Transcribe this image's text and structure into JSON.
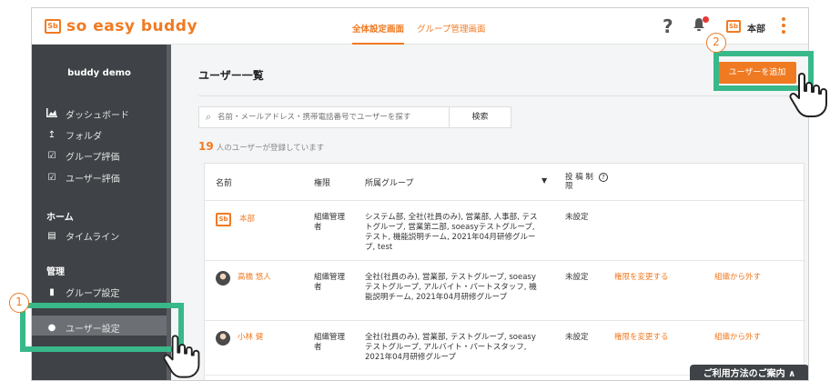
{
  "app": {
    "logo_box": "Sb",
    "logo_text": "so easy buddy",
    "nav": [
      "全体設定画面",
      "グループ管理画面"
    ],
    "help": "?",
    "user_box": "Sb",
    "user_name": "本部"
  },
  "sidebar": {
    "org": "buddy demo",
    "items": [
      {
        "icon": "dashboard-icon",
        "label": "ダッシュボード"
      },
      {
        "icon": "folder-up-icon",
        "label": "フォルダ"
      },
      {
        "icon": "check-icon",
        "label": "グループ評価"
      },
      {
        "icon": "check-icon",
        "label": "ユーザー評価"
      }
    ],
    "home_head": "ホーム",
    "timeline": "タイムライン",
    "manage_head": "管理",
    "group_settings": "グループ設定",
    "user_settings": "ユーザー設定"
  },
  "main": {
    "title": "ユーザー一覧",
    "add_button": "ユーザーを追加",
    "search_placeholder": "名前・メールアドレス・携帯電話番号でユーザーを探す",
    "search_button": "検索",
    "count_num": "19",
    "count_text": "人のユーザーが登録しています",
    "columns": [
      "名前",
      "権限",
      "所属グループ",
      "投 稿 制 限"
    ],
    "rows": [
      {
        "name": "本部",
        "role": "組織管理者",
        "groups": "システム部, 全社(社員のみ), 営業部, 人事部, テストグループ, 営業第二部, soeasyテストグループ, テスト, 機能説明チーム, 2021年04月研修グループ, test",
        "limit": "未設定",
        "change": "",
        "remove": ""
      },
      {
        "name": "高橋 悠人",
        "role": "組織管理者",
        "groups": "全社(社員のみ), 営業部, テストグループ, soeasyテストグループ, アルバイト・パートスタッフ, 機能説明チーム, 2021年04月研修グループ",
        "limit": "未設定",
        "change": "権限を変更する",
        "remove": "組織から外す"
      },
      {
        "name": "小林 健",
        "role": "組織管理者",
        "groups": "全社(社員のみ), 営業部, テストグループ, soeasyテストグループ, アルバイト・パートスタッフ, 2021年04月研修グループ",
        "limit": "未設定",
        "change": "権限を変更する",
        "remove": "組織から外す"
      }
    ]
  },
  "help_tab": "ご利用方法のご案内 ∧",
  "annotations": {
    "step1": "1",
    "step2": "2",
    "highlight_color": "#39b88a"
  },
  "colors": {
    "accent": "#f07a22",
    "sidebar": "#3f4347"
  }
}
